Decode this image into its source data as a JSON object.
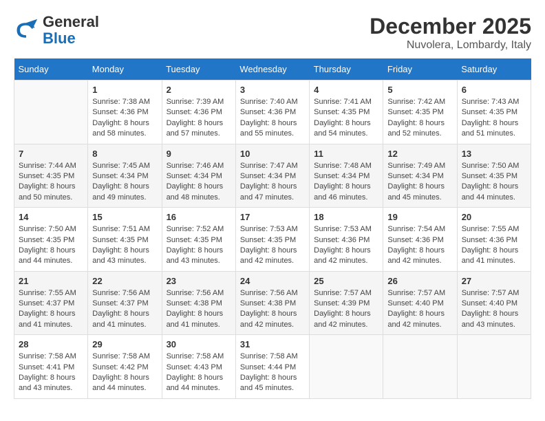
{
  "logo": {
    "text_general": "General",
    "text_blue": "Blue"
  },
  "title": "December 2025",
  "location": "Nuvolera, Lombardy, Italy",
  "days_of_week": [
    "Sunday",
    "Monday",
    "Tuesday",
    "Wednesday",
    "Thursday",
    "Friday",
    "Saturday"
  ],
  "weeks": [
    [
      {
        "day": "",
        "sunrise": "",
        "sunset": "",
        "daylight": ""
      },
      {
        "day": "1",
        "sunrise": "Sunrise: 7:38 AM",
        "sunset": "Sunset: 4:36 PM",
        "daylight": "Daylight: 8 hours and 58 minutes."
      },
      {
        "day": "2",
        "sunrise": "Sunrise: 7:39 AM",
        "sunset": "Sunset: 4:36 PM",
        "daylight": "Daylight: 8 hours and 57 minutes."
      },
      {
        "day": "3",
        "sunrise": "Sunrise: 7:40 AM",
        "sunset": "Sunset: 4:36 PM",
        "daylight": "Daylight: 8 hours and 55 minutes."
      },
      {
        "day": "4",
        "sunrise": "Sunrise: 7:41 AM",
        "sunset": "Sunset: 4:35 PM",
        "daylight": "Daylight: 8 hours and 54 minutes."
      },
      {
        "day": "5",
        "sunrise": "Sunrise: 7:42 AM",
        "sunset": "Sunset: 4:35 PM",
        "daylight": "Daylight: 8 hours and 52 minutes."
      },
      {
        "day": "6",
        "sunrise": "Sunrise: 7:43 AM",
        "sunset": "Sunset: 4:35 PM",
        "daylight": "Daylight: 8 hours and 51 minutes."
      }
    ],
    [
      {
        "day": "7",
        "sunrise": "Sunrise: 7:44 AM",
        "sunset": "Sunset: 4:35 PM",
        "daylight": "Daylight: 8 hours and 50 minutes."
      },
      {
        "day": "8",
        "sunrise": "Sunrise: 7:45 AM",
        "sunset": "Sunset: 4:34 PM",
        "daylight": "Daylight: 8 hours and 49 minutes."
      },
      {
        "day": "9",
        "sunrise": "Sunrise: 7:46 AM",
        "sunset": "Sunset: 4:34 PM",
        "daylight": "Daylight: 8 hours and 48 minutes."
      },
      {
        "day": "10",
        "sunrise": "Sunrise: 7:47 AM",
        "sunset": "Sunset: 4:34 PM",
        "daylight": "Daylight: 8 hours and 47 minutes."
      },
      {
        "day": "11",
        "sunrise": "Sunrise: 7:48 AM",
        "sunset": "Sunset: 4:34 PM",
        "daylight": "Daylight: 8 hours and 46 minutes."
      },
      {
        "day": "12",
        "sunrise": "Sunrise: 7:49 AM",
        "sunset": "Sunset: 4:34 PM",
        "daylight": "Daylight: 8 hours and 45 minutes."
      },
      {
        "day": "13",
        "sunrise": "Sunrise: 7:50 AM",
        "sunset": "Sunset: 4:35 PM",
        "daylight": "Daylight: 8 hours and 44 minutes."
      }
    ],
    [
      {
        "day": "14",
        "sunrise": "Sunrise: 7:50 AM",
        "sunset": "Sunset: 4:35 PM",
        "daylight": "Daylight: 8 hours and 44 minutes."
      },
      {
        "day": "15",
        "sunrise": "Sunrise: 7:51 AM",
        "sunset": "Sunset: 4:35 PM",
        "daylight": "Daylight: 8 hours and 43 minutes."
      },
      {
        "day": "16",
        "sunrise": "Sunrise: 7:52 AM",
        "sunset": "Sunset: 4:35 PM",
        "daylight": "Daylight: 8 hours and 43 minutes."
      },
      {
        "day": "17",
        "sunrise": "Sunrise: 7:53 AM",
        "sunset": "Sunset: 4:35 PM",
        "daylight": "Daylight: 8 hours and 42 minutes."
      },
      {
        "day": "18",
        "sunrise": "Sunrise: 7:53 AM",
        "sunset": "Sunset: 4:36 PM",
        "daylight": "Daylight: 8 hours and 42 minutes."
      },
      {
        "day": "19",
        "sunrise": "Sunrise: 7:54 AM",
        "sunset": "Sunset: 4:36 PM",
        "daylight": "Daylight: 8 hours and 42 minutes."
      },
      {
        "day": "20",
        "sunrise": "Sunrise: 7:55 AM",
        "sunset": "Sunset: 4:36 PM",
        "daylight": "Daylight: 8 hours and 41 minutes."
      }
    ],
    [
      {
        "day": "21",
        "sunrise": "Sunrise: 7:55 AM",
        "sunset": "Sunset: 4:37 PM",
        "daylight": "Daylight: 8 hours and 41 minutes."
      },
      {
        "day": "22",
        "sunrise": "Sunrise: 7:56 AM",
        "sunset": "Sunset: 4:37 PM",
        "daylight": "Daylight: 8 hours and 41 minutes."
      },
      {
        "day": "23",
        "sunrise": "Sunrise: 7:56 AM",
        "sunset": "Sunset: 4:38 PM",
        "daylight": "Daylight: 8 hours and 41 minutes."
      },
      {
        "day": "24",
        "sunrise": "Sunrise: 7:56 AM",
        "sunset": "Sunset: 4:38 PM",
        "daylight": "Daylight: 8 hours and 42 minutes."
      },
      {
        "day": "25",
        "sunrise": "Sunrise: 7:57 AM",
        "sunset": "Sunset: 4:39 PM",
        "daylight": "Daylight: 8 hours and 42 minutes."
      },
      {
        "day": "26",
        "sunrise": "Sunrise: 7:57 AM",
        "sunset": "Sunset: 4:40 PM",
        "daylight": "Daylight: 8 hours and 42 minutes."
      },
      {
        "day": "27",
        "sunrise": "Sunrise: 7:57 AM",
        "sunset": "Sunset: 4:40 PM",
        "daylight": "Daylight: 8 hours and 43 minutes."
      }
    ],
    [
      {
        "day": "28",
        "sunrise": "Sunrise: 7:58 AM",
        "sunset": "Sunset: 4:41 PM",
        "daylight": "Daylight: 8 hours and 43 minutes."
      },
      {
        "day": "29",
        "sunrise": "Sunrise: 7:58 AM",
        "sunset": "Sunset: 4:42 PM",
        "daylight": "Daylight: 8 hours and 44 minutes."
      },
      {
        "day": "30",
        "sunrise": "Sunrise: 7:58 AM",
        "sunset": "Sunset: 4:43 PM",
        "daylight": "Daylight: 8 hours and 44 minutes."
      },
      {
        "day": "31",
        "sunrise": "Sunrise: 7:58 AM",
        "sunset": "Sunset: 4:44 PM",
        "daylight": "Daylight: 8 hours and 45 minutes."
      },
      {
        "day": "",
        "sunrise": "",
        "sunset": "",
        "daylight": ""
      },
      {
        "day": "",
        "sunrise": "",
        "sunset": "",
        "daylight": ""
      },
      {
        "day": "",
        "sunrise": "",
        "sunset": "",
        "daylight": ""
      }
    ]
  ]
}
